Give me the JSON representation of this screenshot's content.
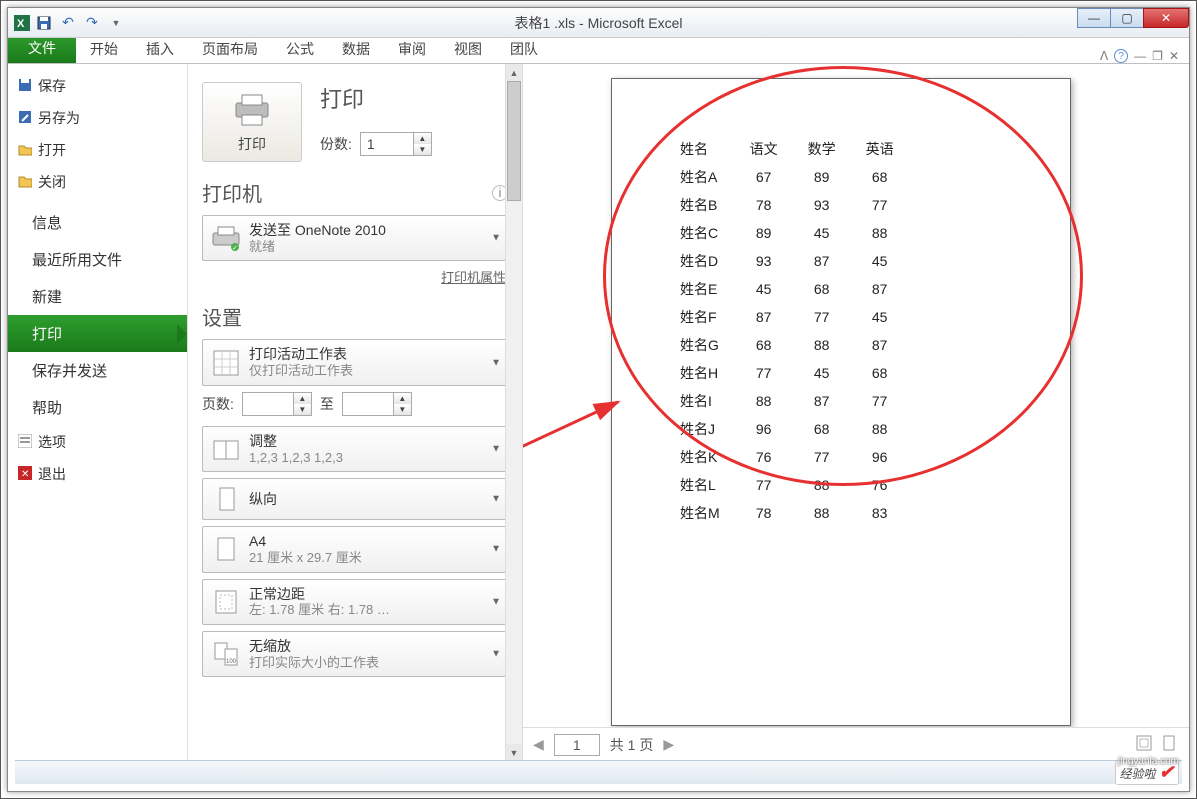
{
  "title": "表格1 .xls - Microsoft Excel",
  "qat": {
    "save_tip": "保存",
    "undo_tip": "撤销",
    "redo_tip": "重做"
  },
  "tabs": {
    "file": "文件",
    "home": "开始",
    "insert": "插入",
    "layout": "页面布局",
    "formulas": "公式",
    "data": "数据",
    "review": "审阅",
    "view": "视图",
    "team": "团队"
  },
  "backstage_left": {
    "save": "保存",
    "save_as": "另存为",
    "open": "打开",
    "close": "关闭",
    "info": "信息",
    "recent": "最近所用文件",
    "new": "新建",
    "print": "打印",
    "save_send": "保存并发送",
    "help": "帮助",
    "options": "选项",
    "exit": "退出"
  },
  "print": {
    "header": "打印",
    "button": "打印",
    "copies_label": "份数:",
    "copies_value": "1",
    "printer_header": "打印机",
    "printer_name": "发送至 OneNote 2010",
    "printer_status": "就绪",
    "printer_props": "打印机属性",
    "settings_header": "设置",
    "scope_main": "打印活动工作表",
    "scope_sub": "仅打印活动工作表",
    "pages_label": "页数:",
    "pages_to": "至",
    "collate_main": "调整",
    "collate_sub": "1,2,3    1,2,3    1,2,3",
    "orient_main": "纵向",
    "size_main": "A4",
    "size_sub": "21 厘米 x 29.7 厘米",
    "margin_main": "正常边距",
    "margin_sub": "左: 1.78 厘米   右: 1.78 …",
    "scale_main": "无缩放",
    "scale_sub": "打印实际大小的工作表"
  },
  "preview": {
    "headers": [
      "姓名",
      "语文",
      "数学",
      "英语"
    ],
    "rows": [
      {
        "name": "姓名A",
        "c1": "67",
        "c2": "89",
        "c3": "68"
      },
      {
        "name": "姓名B",
        "c1": "78",
        "c2": "93",
        "c3": "77"
      },
      {
        "name": "姓名C",
        "c1": "89",
        "c2": "45",
        "c3": "88"
      },
      {
        "name": "姓名D",
        "c1": "93",
        "c2": "87",
        "c3": "45"
      },
      {
        "name": "姓名E",
        "c1": "45",
        "c2": "68",
        "c3": "87"
      },
      {
        "name": "姓名F",
        "c1": "87",
        "c2": "77",
        "c3": "45"
      },
      {
        "name": "姓名G",
        "c1": "68",
        "c2": "88",
        "c3": "87"
      },
      {
        "name": "姓名H",
        "c1": "77",
        "c2": "45",
        "c3": "68"
      },
      {
        "name": "姓名I",
        "c1": "88",
        "c2": "87",
        "c3": "77"
      },
      {
        "name": "姓名J",
        "c1": "96",
        "c2": "68",
        "c3": "88"
      },
      {
        "name": "姓名K",
        "c1": "76",
        "c2": "77",
        "c3": "96"
      },
      {
        "name": "姓名L",
        "c1": "77",
        "c2": "88",
        "c3": "76"
      },
      {
        "name": "姓名M",
        "c1": "78",
        "c2": "88",
        "c3": "83"
      }
    ],
    "cur_page": "1",
    "page_total_label": "共 1 页"
  },
  "watermark": {
    "text": "经验啦",
    "domain": "jingyanla.com"
  }
}
